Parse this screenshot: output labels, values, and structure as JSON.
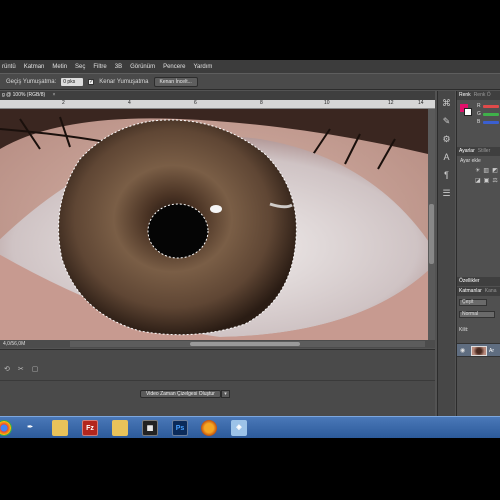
{
  "menu": [
    "rüntü",
    "Katman",
    "Metin",
    "Seç",
    "Filtre",
    "3B",
    "Görünüm",
    "Pencere",
    "Yardım"
  ],
  "options": {
    "feather_label": "Geçiş Yumuşatma:",
    "feather_value": "0 pks",
    "antialias_label": "Kenar Yumuşatma",
    "refine_button": "Kenarı İncelt..."
  },
  "document": {
    "tab_title": "g @ 100% (RGB/8)",
    "close_glyph": "×",
    "ruler_ticks": [
      "2",
      "4",
      "6",
      "8",
      "10",
      "12",
      "14"
    ],
    "status": "4,0/56,0M",
    "zoom_partial": "%"
  },
  "timeline": {
    "create_button": "Video Zaman Çizelgesi Oluştur",
    "dropdown_glyph": "▾",
    "tools": [
      "⟲",
      "✂",
      "▢"
    ]
  },
  "panels": {
    "color_tabs": [
      "Renk",
      "Renk Ö"
    ],
    "channels": [
      "R",
      "G",
      "B"
    ],
    "channel_colors": [
      "#e04a4a",
      "#3fb04a",
      "#3a5fd0"
    ],
    "fg_color": "#e0106a",
    "bg_color": "#ffffff",
    "adjust_tabs": [
      "Ayarlar",
      "Stiller"
    ],
    "add_adjustment": "Ayar ekle",
    "props_tab": "Özellikler",
    "layers_tabs": [
      "Katmanlar",
      "Kana"
    ],
    "kind_label": "Çeşit",
    "blend_mode": "Normal",
    "lock_label": "Kilit:",
    "layer_name": "Ar"
  },
  "icon_strip": [
    "history-icon",
    "brush-icon",
    "adjust-icon",
    "text-icon",
    "paragraph-icon",
    "layers-icon"
  ],
  "taskbar": {
    "icons": [
      "chrome-icon",
      "pen-icon",
      "folder-icon",
      "filezilla-icon",
      "folder-icon",
      "film-icon",
      "photoshop-icon",
      "media-icon",
      "settings-icon"
    ],
    "ps_label": "Ps",
    "fz_label": "Fz"
  }
}
